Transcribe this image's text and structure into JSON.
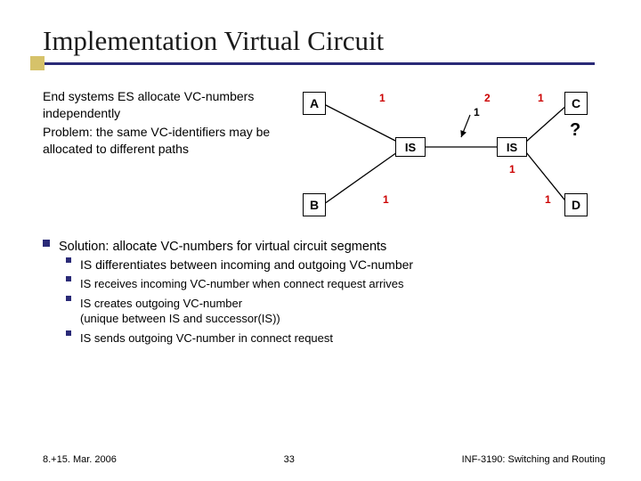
{
  "title": "Implementation Virtual Circuit",
  "intro": {
    "line1": "End systems ES allocate VC-numbers independently",
    "line2": "Problem: the same VC-identifiers may be allocated to different paths"
  },
  "diagram": {
    "nodes": {
      "A": "A",
      "B": "B",
      "C": "C",
      "D": "D",
      "IS1": "IS",
      "IS2": "IS"
    },
    "labels": {
      "a_out": "1",
      "mid_top": "2",
      "c_in": "1",
      "mid_arrow": "1",
      "b_out": "1",
      "is2_down": "1",
      "d_in": "1"
    },
    "question": "?"
  },
  "bullets": {
    "l1": "Solution: allocate VC-numbers for virtual circuit segments",
    "l2": "IS differentiates between incoming and outgoing VC-number",
    "l3a": "IS receives incoming VC-number when connect request arrives",
    "l3b": "IS creates outgoing VC-number\n(unique between IS and successor(IS))",
    "l3c": "IS sends outgoing VC-number in connect request"
  },
  "footer": {
    "left": "8.+15. Mar. 2006",
    "center": "33",
    "right": "INF-3190: Switching and Routing"
  }
}
